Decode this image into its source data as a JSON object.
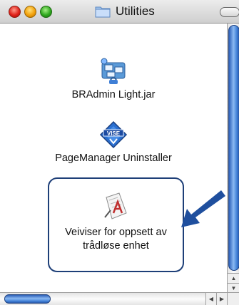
{
  "window": {
    "title": "Utilities",
    "title_icon": "folder-icon"
  },
  "items": [
    {
      "label": "BRAdmin Light.jar",
      "icon": "java-app-network-icon"
    },
    {
      "label": "PageManager Uninstaller",
      "icon": "vise-installer-icon"
    },
    {
      "label_line1": "Veiviser for oppsett av",
      "label_line2": "trådløse enhet",
      "icon": "application-script-icon"
    }
  ],
  "colors": {
    "highlight_border": "#1e3f78",
    "arrow": "#1f4f9e"
  }
}
